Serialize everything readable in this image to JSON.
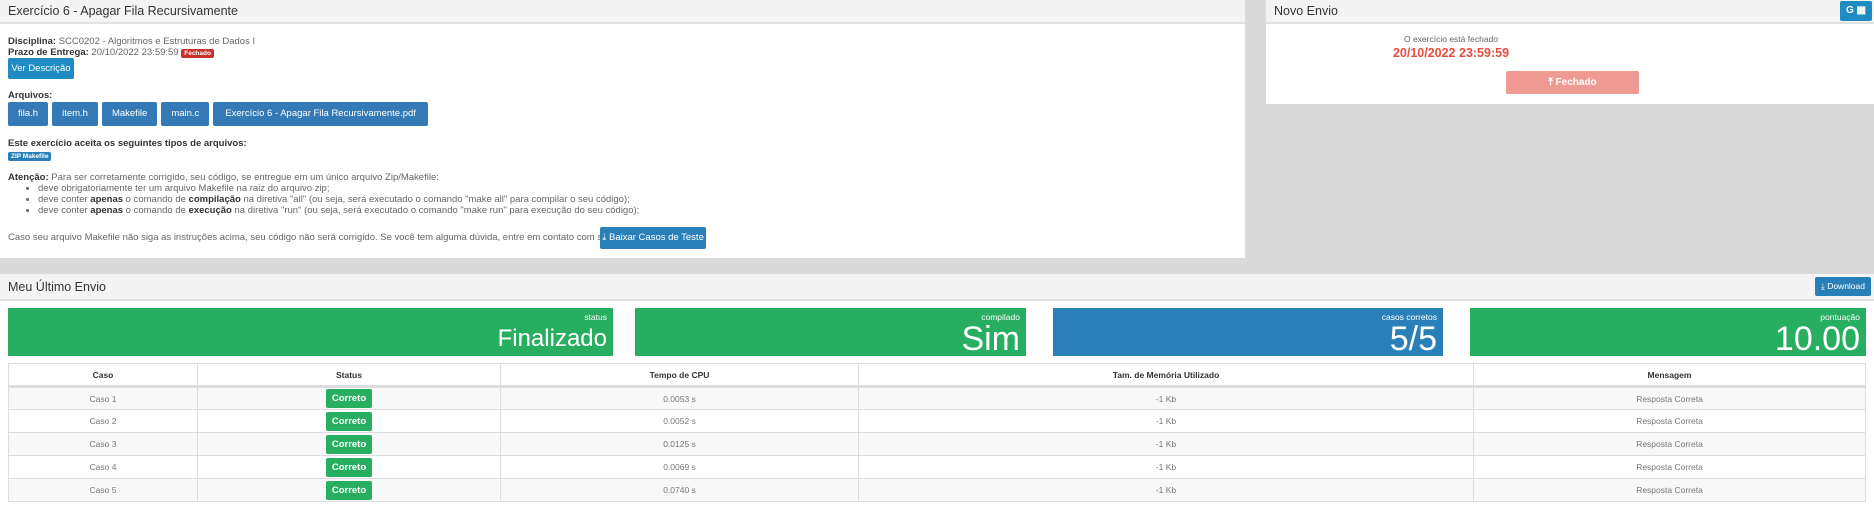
{
  "exercise": {
    "title": "Exercício 6 - Apagar Fila Recursivamente",
    "discipline_label": "Disciplina:",
    "discipline": "SCC0202 - Algoritmos e Estruturas de Dados I",
    "deadline_label": "Prazo de Entrega:",
    "deadline": "20/10/2022 23:59:59",
    "closed_badge": "Fechado",
    "view_description": "Ver Descrição",
    "files_label": "Arquivos:",
    "files": [
      "fila.h",
      "item.h",
      "Makefile",
      "main.c",
      "Exercício 6 - Apagar Fila Recursivamente.pdf"
    ],
    "accepts_label": "Este exercício aceita os seguintes tipos de arquivos:",
    "accepted_type": "ZIP Makefile",
    "attention_label": "Atenção:",
    "attention_text": "Para ser corretamente corrigido, seu código, se entregue em um único arquivo Zip/Makefile:",
    "bullet1": "deve obrigatoriamente ter um arquivo Makefile na raiz do arquivo zip;",
    "bullet2": {
      "a": "deve conter ",
      "b": "apenas",
      "c": " o comando de ",
      "d": "compilação",
      "e": " na diretiva \"all\" (ou seja, será executado o comando \"make all\" para compilar o seu código);"
    },
    "bullet3": {
      "a": "deve conter ",
      "b": "apenas",
      "c": " o comando de ",
      "d": "execução",
      "e": " na diretiva \"run\" (ou seja, será executado o comando \"make run\" para execução do seu código);"
    },
    "footer_text": "Caso seu arquivo Makefile não siga as instruções acima, seu código não será corrigido. Se você tem alguma dúvida, entre em contato com support@run.codes.",
    "download_tests": "Baixar Casos de Teste"
  },
  "new_submission": {
    "title": "Novo Envio",
    "calendar_button": "G",
    "closed_text": "O exercício está fechado",
    "deadline": "20/10/2022 23:59:59",
    "closed_button": "Fechado"
  },
  "last_submission": {
    "title": "Meu Último Envio",
    "download": "Download",
    "cards": [
      {
        "label": "status",
        "value": "Finalizado",
        "color": "#27ae60"
      },
      {
        "label": "compilado",
        "value": "Sim",
        "color": "#27ae60"
      },
      {
        "label": "casos corretos",
        "value": "5/5",
        "color": "#2980b9"
      },
      {
        "label": "pontuação",
        "value": "10.00",
        "color": "#27ae60"
      }
    ],
    "columns": [
      "Caso",
      "Status",
      "Tempo de CPU",
      "Tam. de Memória Utilizado",
      "Mensagem"
    ],
    "rows": [
      [
        "Caso 1",
        "Correto",
        "0.0053 s",
        "-1 Kb",
        "Resposta Correta"
      ],
      [
        "Caso 2",
        "Correto",
        "0.0052 s",
        "-1 Kb",
        "Resposta Correta"
      ],
      [
        "Caso 3",
        "Correto",
        "0.0125 s",
        "-1 Kb",
        "Resposta Correta"
      ],
      [
        "Caso 4",
        "Correto",
        "0.0069 s",
        "-1 Kb",
        "Resposta Correta"
      ],
      [
        "Caso 5",
        "Correto",
        "0.0740 s",
        "-1 Kb",
        "Resposta Correta"
      ]
    ]
  }
}
